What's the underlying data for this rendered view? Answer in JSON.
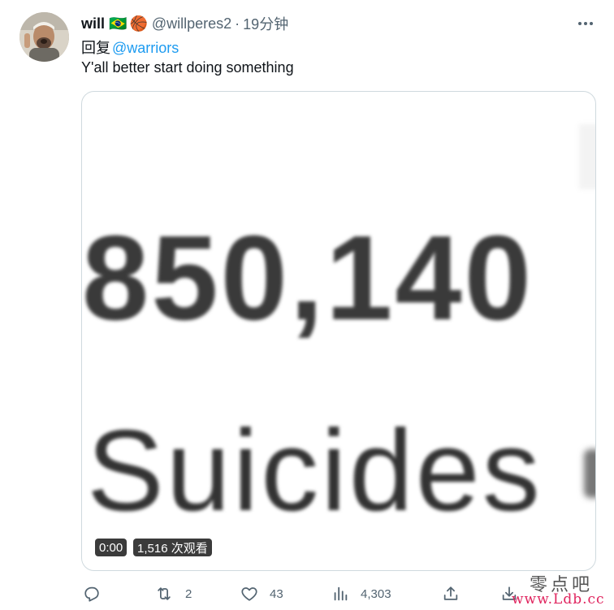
{
  "tweet": {
    "author_name": "will",
    "flag_emoji": "🇧🇷",
    "badge_emoji": "🏀",
    "handle": "@willperes2",
    "separator": "·",
    "time": "19分钟",
    "reply_prefix": "回复",
    "reply_mention": "@warriors",
    "text": "Y'all better start doing something"
  },
  "media": {
    "video_text_number": "850,140",
    "video_text_word": "Suicides",
    "duration": "0:00",
    "views": "1,516 次观看"
  },
  "actions": {
    "reply_icon": "reply-icon",
    "retweet_icon": "retweet-icon",
    "retweet_count": "2",
    "like_icon": "like-icon",
    "like_count": "43",
    "views_icon": "views-icon",
    "views_count": "4,303",
    "share_icon": "share-icon",
    "download_icon": "download-icon"
  },
  "watermark": {
    "top": "零点吧",
    "bottom": "www.Ldb.cc"
  },
  "colors": {
    "accent": "#1d9bf0",
    "secondary_text": "#536471",
    "primary_text": "#0f1419",
    "watermark_red": "#e0245e"
  }
}
